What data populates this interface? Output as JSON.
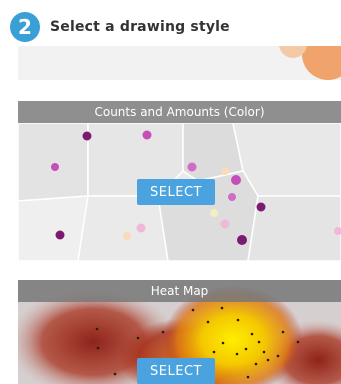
{
  "step": {
    "number": "2",
    "title": "Select a drawing style"
  },
  "styles": [
    {
      "title": "Counts and Amounts (Color)",
      "button": "SELECT"
    },
    {
      "title": "Heat Map",
      "button": "SELECT"
    }
  ],
  "colors": {
    "badge": "#3a9fd6",
    "button": "#4aa3df",
    "header": "#8f8f8f",
    "dot_dark": "#7b1a6e",
    "dot_mid": "#c44fb8",
    "dot_light": "#f0b8d8",
    "dot_pale": "#f8dcb8",
    "orange_accent": "#f0a36a"
  }
}
